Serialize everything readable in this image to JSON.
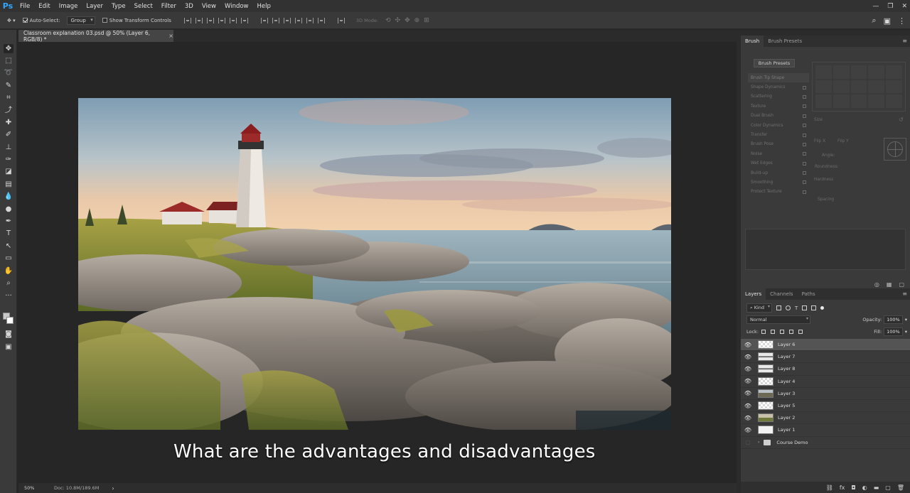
{
  "app": {
    "logo": "Ps",
    "menu": [
      "File",
      "Edit",
      "Image",
      "Layer",
      "Type",
      "Select",
      "Filter",
      "3D",
      "View",
      "Window",
      "Help"
    ],
    "window_controls": [
      "—",
      "❐",
      "✕"
    ]
  },
  "options_bar": {
    "auto_select_label": "Auto-Select:",
    "auto_select_checked": true,
    "auto_select_target": "Group",
    "show_transform_label": "Show Transform Controls",
    "mode_3d_label": "3D Mode:"
  },
  "document": {
    "tab_title": "Classroom explanation 03.psd @ 50% (Layer 6, RGB/8) *",
    "close_glyph": "×"
  },
  "subtitle": "What are the advantages and disadvantages",
  "status": {
    "zoom": "50%",
    "doc_info": "Doc: 10.8M/189.6M",
    "arrow": "›"
  },
  "brush_panel": {
    "tabs": [
      "Brush",
      "Brush Presets"
    ],
    "presets_button": "Brush Presets",
    "options": [
      "Brush Tip Shape",
      "Shape Dynamics",
      "Scattering",
      "Texture",
      "Dual Brush",
      "Color Dynamics",
      "Transfer",
      "Brush Pose",
      "Noise",
      "Wet Edges",
      "Build-up",
      "Smoothing",
      "Protect Texture"
    ],
    "params": {
      "size": "Size",
      "flip_x": "Flip X",
      "flip_y": "Flip Y",
      "angle": "Angle:",
      "roundness": "Roundness:",
      "hardness": "Hardness",
      "spacing": "Spacing"
    }
  },
  "layers_panel": {
    "tabs": [
      "Layers",
      "Channels",
      "Paths"
    ],
    "filter_kind": "Kind",
    "blend_mode": "Normal",
    "opacity_label": "Opacity:",
    "opacity_value": "100%",
    "lock_label": "Lock:",
    "fill_label": "Fill:",
    "fill_value": "100%",
    "layers": [
      {
        "name": "Layer 6",
        "thumb": "checker",
        "selected": true
      },
      {
        "name": "Layer 7",
        "thumb": "rocks",
        "selected": false
      },
      {
        "name": "Layer 8",
        "thumb": "rocks",
        "selected": false
      },
      {
        "name": "Layer 4",
        "thumb": "checker",
        "selected": false
      },
      {
        "name": "Layer 3",
        "thumb": "land",
        "selected": false
      },
      {
        "name": "Layer 5",
        "thumb": "checker",
        "selected": false
      },
      {
        "name": "Layer 2",
        "thumb": "green",
        "selected": false
      },
      {
        "name": "Layer 1",
        "thumb": "white",
        "selected": false
      }
    ],
    "group": {
      "name": "Course Demo"
    }
  },
  "colors": {
    "accent_ps": "#31a8ff",
    "panel_bg": "#3a3a3a",
    "canvas_bg": "#262626",
    "selected_layer": "#545454"
  }
}
